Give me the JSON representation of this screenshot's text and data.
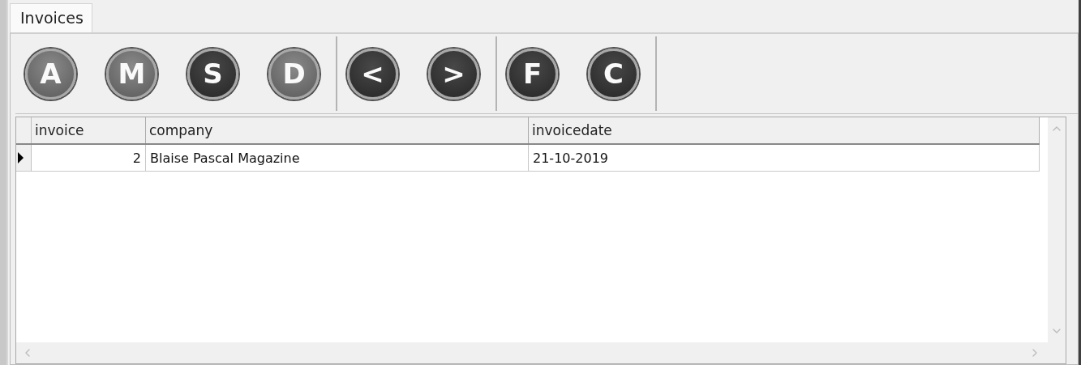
{
  "tabs": [
    {
      "label": "Invoices",
      "selected": true
    }
  ],
  "toolbar": {
    "groups": [
      {
        "buttons": [
          {
            "label": "A",
            "disabled": true
          },
          {
            "label": "M",
            "disabled": true
          },
          {
            "label": "S",
            "disabled": false
          },
          {
            "label": "D",
            "disabled": true
          }
        ]
      },
      {
        "buttons": [
          {
            "label": "<",
            "disabled": false
          },
          {
            "label": ">",
            "disabled": false
          }
        ]
      },
      {
        "buttons": [
          {
            "label": "F",
            "disabled": false
          },
          {
            "label": "C",
            "disabled": false
          }
        ]
      }
    ]
  },
  "table": {
    "columns": [
      "invoice",
      "company",
      "invoicedate"
    ],
    "rows": [
      {
        "selected": true,
        "cells": [
          "2",
          "Blaise Pascal Magazine",
          "21-10-2019"
        ]
      }
    ]
  }
}
